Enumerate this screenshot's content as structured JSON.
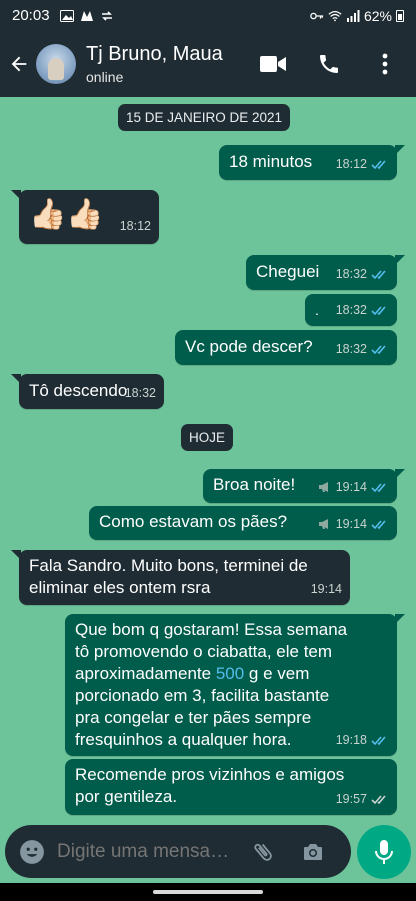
{
  "status_bar": {
    "time": "20:03",
    "battery": "62%"
  },
  "header": {
    "contact_name": "Tj Bruno, Maua",
    "contact_status": "online"
  },
  "chat": {
    "date_dividers": [
      "15 DE JANEIRO DE 2021",
      "HOJE"
    ],
    "messages": [
      {
        "dir": "out",
        "text": "18 minutos",
        "time": "18:12",
        "read": true
      },
      {
        "dir": "in",
        "text": "👍🏻👍🏻",
        "time": "18:12"
      },
      {
        "dir": "out",
        "text": "Cheguei",
        "time": "18:32",
        "read": true
      },
      {
        "dir": "out",
        "text": ".",
        "time": "18:32",
        "read": true
      },
      {
        "dir": "out",
        "text": "Vc pode descer?",
        "time": "18:32",
        "read": true
      },
      {
        "dir": "in",
        "text": "Tô descendo",
        "time": "18:32"
      },
      {
        "dir": "out",
        "text": "Broa noite!",
        "time": "19:14",
        "read": true,
        "broadcast": true
      },
      {
        "dir": "out",
        "text": "Como estavam os pães?",
        "time": "19:14",
        "read": true,
        "broadcast": true
      },
      {
        "dir": "in",
        "text": "Fala Sandro. Muito bons, terminei de\neliminar eles ontem rsra",
        "time": "19:14"
      },
      {
        "dir": "out",
        "text_before": "Que bom q gostaram! Essa semana\ntô promovendo o ciabatta, ele tem\naproximadamente ",
        "text_highlight": "500",
        "text_after": " g e vem\nporcionado em 3, facilita bastante\npra congelar e ter pães sempre\nfresquinhos a qualquer hora.",
        "time": "19:18",
        "read": true
      },
      {
        "dir": "out",
        "text": "Recomende pros vizinhos e amigos\npor gentileza.",
        "time": "19:57",
        "read": false
      }
    ]
  },
  "composer": {
    "placeholder": "Digite uma mensa…"
  },
  "colors": {
    "chat_background": "#6ec49a",
    "outgoing_bubble": "#005c4b",
    "incoming_bubble": "#1f2c33",
    "header": "#1f2c33",
    "read_ticks": "#53bdeb",
    "mic_button": "#00a884"
  },
  "icons": [
    "back-arrow-icon",
    "video-call-icon",
    "phone-icon",
    "more-options-icon",
    "emoji-icon",
    "attach-icon",
    "camera-icon",
    "mic-icon",
    "double-check-icon",
    "broadcast-icon"
  ]
}
